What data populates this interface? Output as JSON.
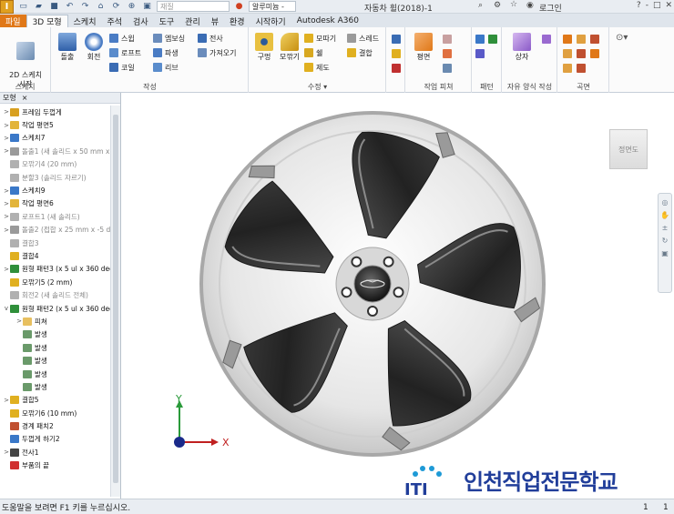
{
  "app": {
    "menu_button_label": "I",
    "search_placeholder": "재질",
    "appearance_value": "알루미늄 -",
    "document_title": "자동차 휠(2018)-1",
    "login_label": "로그인",
    "window_controls": [
      "?",
      "-",
      "□",
      "✕"
    ]
  },
  "tabs": [
    "파일",
    "3D 모형",
    "스케치",
    "주석",
    "검사",
    "도구",
    "관리",
    "뷰",
    "환경",
    "시작하기",
    "Autodesk A360"
  ],
  "ribbon": {
    "sketch": {
      "button": "2D 스케치\n시작",
      "title": "스케치"
    },
    "create": {
      "extrude": "돌출",
      "revolve": "회전",
      "smalls": [
        "스윕",
        "로프트",
        "코일",
        "엠보싱",
        "파생",
        "리브",
        "전사",
        "가져오기"
      ],
      "title": "작성"
    },
    "modify": {
      "hole": "구멍",
      "fillet": "모깎기",
      "smalls": [
        "모따기",
        "쉘",
        "제도",
        "스레드",
        "결합"
      ],
      "title": "수정 ▾"
    },
    "work": {
      "plane": "평면",
      "title": "작업 피쳐"
    },
    "pattern": {
      "title": "패턴"
    },
    "freeform": {
      "box": "상자",
      "title": "자유 양식 작성"
    },
    "surface": {
      "title": "곡면"
    }
  },
  "browser": {
    "tab_label": "모형",
    "close_glyph": "×",
    "nodes": [
      {
        "toggle": ">",
        "indent": 0,
        "color": "#d8a020",
        "label": "프레임 두껍게",
        "dim": false
      },
      {
        "toggle": ">",
        "indent": 0,
        "color": "#e2b43a",
        "label": "작업 평면5",
        "dim": false
      },
      {
        "toggle": ">",
        "indent": 0,
        "color": "#3a78c8",
        "label": "스케치7",
        "dim": false
      },
      {
        "toggle": ">",
        "indent": 0,
        "color": "#9a9a9a",
        "label": "돌출1 (새 솔리드 x 50 mm x",
        "dim": true
      },
      {
        "toggle": "",
        "indent": 0,
        "color": "#b0b0b0",
        "label": "모깎기4 (20 mm)",
        "dim": true
      },
      {
        "toggle": "",
        "indent": 0,
        "color": "#b0b0b0",
        "label": "분할3 (솔리드 자르기)",
        "dim": true
      },
      {
        "toggle": ">",
        "indent": 0,
        "color": "#3a78c8",
        "label": "스케치9",
        "dim": false
      },
      {
        "toggle": ">",
        "indent": 0,
        "color": "#e2b43a",
        "label": "작업 평면6",
        "dim": false
      },
      {
        "toggle": ">",
        "indent": 0,
        "color": "#b0b0b0",
        "label": "로프트1 (새 솔리드)",
        "dim": true
      },
      {
        "toggle": ">",
        "indent": 0,
        "color": "#9a9a9a",
        "label": "돌출2 (접합 x 25 mm x -5 d",
        "dim": true
      },
      {
        "toggle": "",
        "indent": 0,
        "color": "#b0b0b0",
        "label": "결합3",
        "dim": true
      },
      {
        "toggle": "",
        "indent": 0,
        "color": "#e0b020",
        "label": "결합4",
        "dim": false
      },
      {
        "toggle": ">",
        "indent": 0,
        "color": "#2f8f3a",
        "label": "원형 패턴3 (x 5 ul x 360 deg",
        "dim": false
      },
      {
        "toggle": "",
        "indent": 0,
        "color": "#e0b020",
        "label": "모깎기5 (2 mm)",
        "dim": false
      },
      {
        "toggle": "",
        "indent": 0,
        "color": "#b0b0b0",
        "label": "회전2 (새 솔리드 전체)",
        "dim": true
      },
      {
        "toggle": "v",
        "indent": 0,
        "color": "#2f8f3a",
        "label": "원형 패턴2 (x 5 ul x 360 deg",
        "dim": false
      },
      {
        "toggle": ">",
        "indent": 1,
        "color": "#e8c060",
        "label": "피쳐",
        "dim": false
      },
      {
        "toggle": "",
        "indent": 1,
        "color": "#6a9a6a",
        "label": "발생",
        "dim": false
      },
      {
        "toggle": "",
        "indent": 1,
        "color": "#6a9a6a",
        "label": "발생",
        "dim": false
      },
      {
        "toggle": "",
        "indent": 1,
        "color": "#6a9a6a",
        "label": "발생",
        "dim": false
      },
      {
        "toggle": "",
        "indent": 1,
        "color": "#6a9a6a",
        "label": "발생",
        "dim": false
      },
      {
        "toggle": "",
        "indent": 1,
        "color": "#6a9a6a",
        "label": "발생",
        "dim": false
      },
      {
        "toggle": ">",
        "indent": 0,
        "color": "#e0b020",
        "label": "결합5",
        "dim": false
      },
      {
        "toggle": "",
        "indent": 0,
        "color": "#e0b020",
        "label": "모깎기6 (10 mm)",
        "dim": false
      },
      {
        "toggle": "",
        "indent": 0,
        "color": "#c05030",
        "label": "경계 패치2",
        "dim": false
      },
      {
        "toggle": "",
        "indent": 0,
        "color": "#3a78c8",
        "label": "두껍게 하기2",
        "dim": false
      },
      {
        "toggle": ">",
        "indent": 0,
        "color": "#444444",
        "label": "전사1",
        "dim": false
      },
      {
        "toggle": "",
        "indent": 0,
        "color": "#d03030",
        "label": "부품의 끝",
        "dim": false
      }
    ]
  },
  "viewport": {
    "viewcube_label": "정면도",
    "axis_x": "X",
    "axis_y": "Y",
    "watermark": "인천직업전문학교",
    "watermark_logo": "ITI",
    "nav_icons": [
      "steering-wheel",
      "pan",
      "zoom",
      "orbit",
      "look-at"
    ]
  },
  "status": {
    "message": "도움말을 보려면 F1 키를 누르십시오.",
    "count1": "1",
    "count2": "1"
  },
  "colors": {
    "file_tab": "#e07818",
    "accent_blue": "#213e9a",
    "wheel_dark": "#2b2b2b",
    "wheel_silver": "#d4d4d4"
  }
}
